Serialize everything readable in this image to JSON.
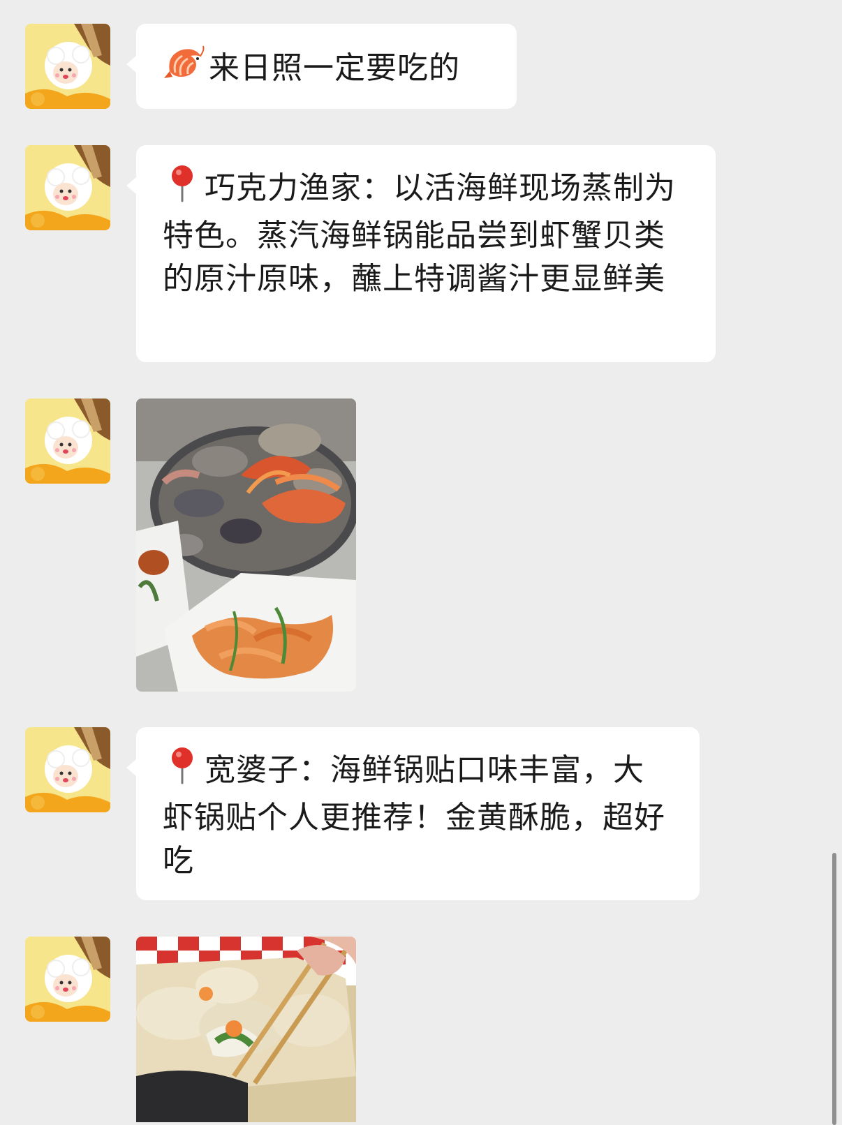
{
  "messages": [
    {
      "type": "text",
      "icon": "shrimp-icon",
      "text": "来日照一定要吃的"
    },
    {
      "type": "text",
      "icon": "round-pushpin-icon",
      "text": "巧克力渔家：以活海鲜现场蒸制为特色。蒸汽海鲜锅能品尝到虾蟹贝类的原汁原味，蘸上特调酱汁更显鲜美"
    },
    {
      "type": "image",
      "subject": "seafood-pot-photo"
    },
    {
      "type": "text",
      "icon": "round-pushpin-icon",
      "text": "宽婆子：海鲜锅贴口味丰富，大虾锅贴个人更推荐！金黄酥脆，超好吃"
    },
    {
      "type": "image",
      "subject": "potsticker-photo"
    }
  ],
  "colors": {
    "background": "#ededed",
    "bubble": "#ffffff",
    "text": "#1a1a1a"
  }
}
